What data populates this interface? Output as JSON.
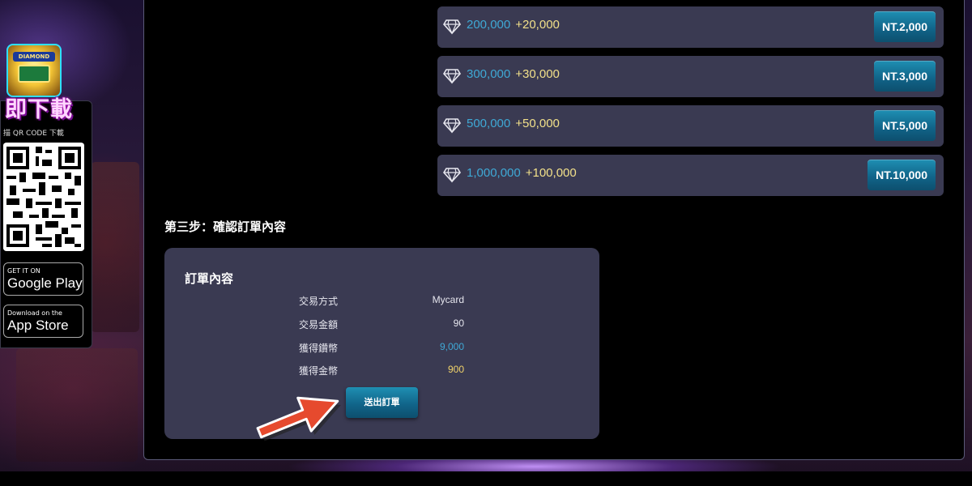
{
  "sidebar": {
    "download_title": "即下載",
    "qr_caption": "描 QR CODE 下載",
    "google_play": {
      "small": "GET IT ON",
      "big": "Google Play"
    },
    "app_store": {
      "small": "Download on the",
      "big": "App Store"
    },
    "logo_text": "DIAMOND"
  },
  "packages": [
    {
      "amount": "200,000",
      "bonus": "+20,000",
      "price": "NT.2,000"
    },
    {
      "amount": "300,000",
      "bonus": "+30,000",
      "price": "NT.3,000"
    },
    {
      "amount": "500,000",
      "bonus": "+50,000",
      "price": "NT.5,000"
    },
    {
      "amount": "1,000,000",
      "bonus": "+100,000",
      "price": "NT.10,000"
    }
  ],
  "step3": {
    "title": "第三步：確認訂單內容",
    "card_title": "訂單內容",
    "rows": [
      {
        "label": "交易方式",
        "value": "Mycard"
      },
      {
        "label": "交易金額",
        "value": "90"
      },
      {
        "label": "獲得鑽幣",
        "value": "9,000"
      },
      {
        "label": "獲得金幣",
        "value": "900"
      }
    ],
    "submit_label": "送出訂單"
  },
  "colors": {
    "accent_blue": "#3fa9d6",
    "bonus_gold": "#f2e08a",
    "button_teal": "#11658a",
    "card_bg": "#3a3a52",
    "arrow_red": "#e64a2e"
  }
}
